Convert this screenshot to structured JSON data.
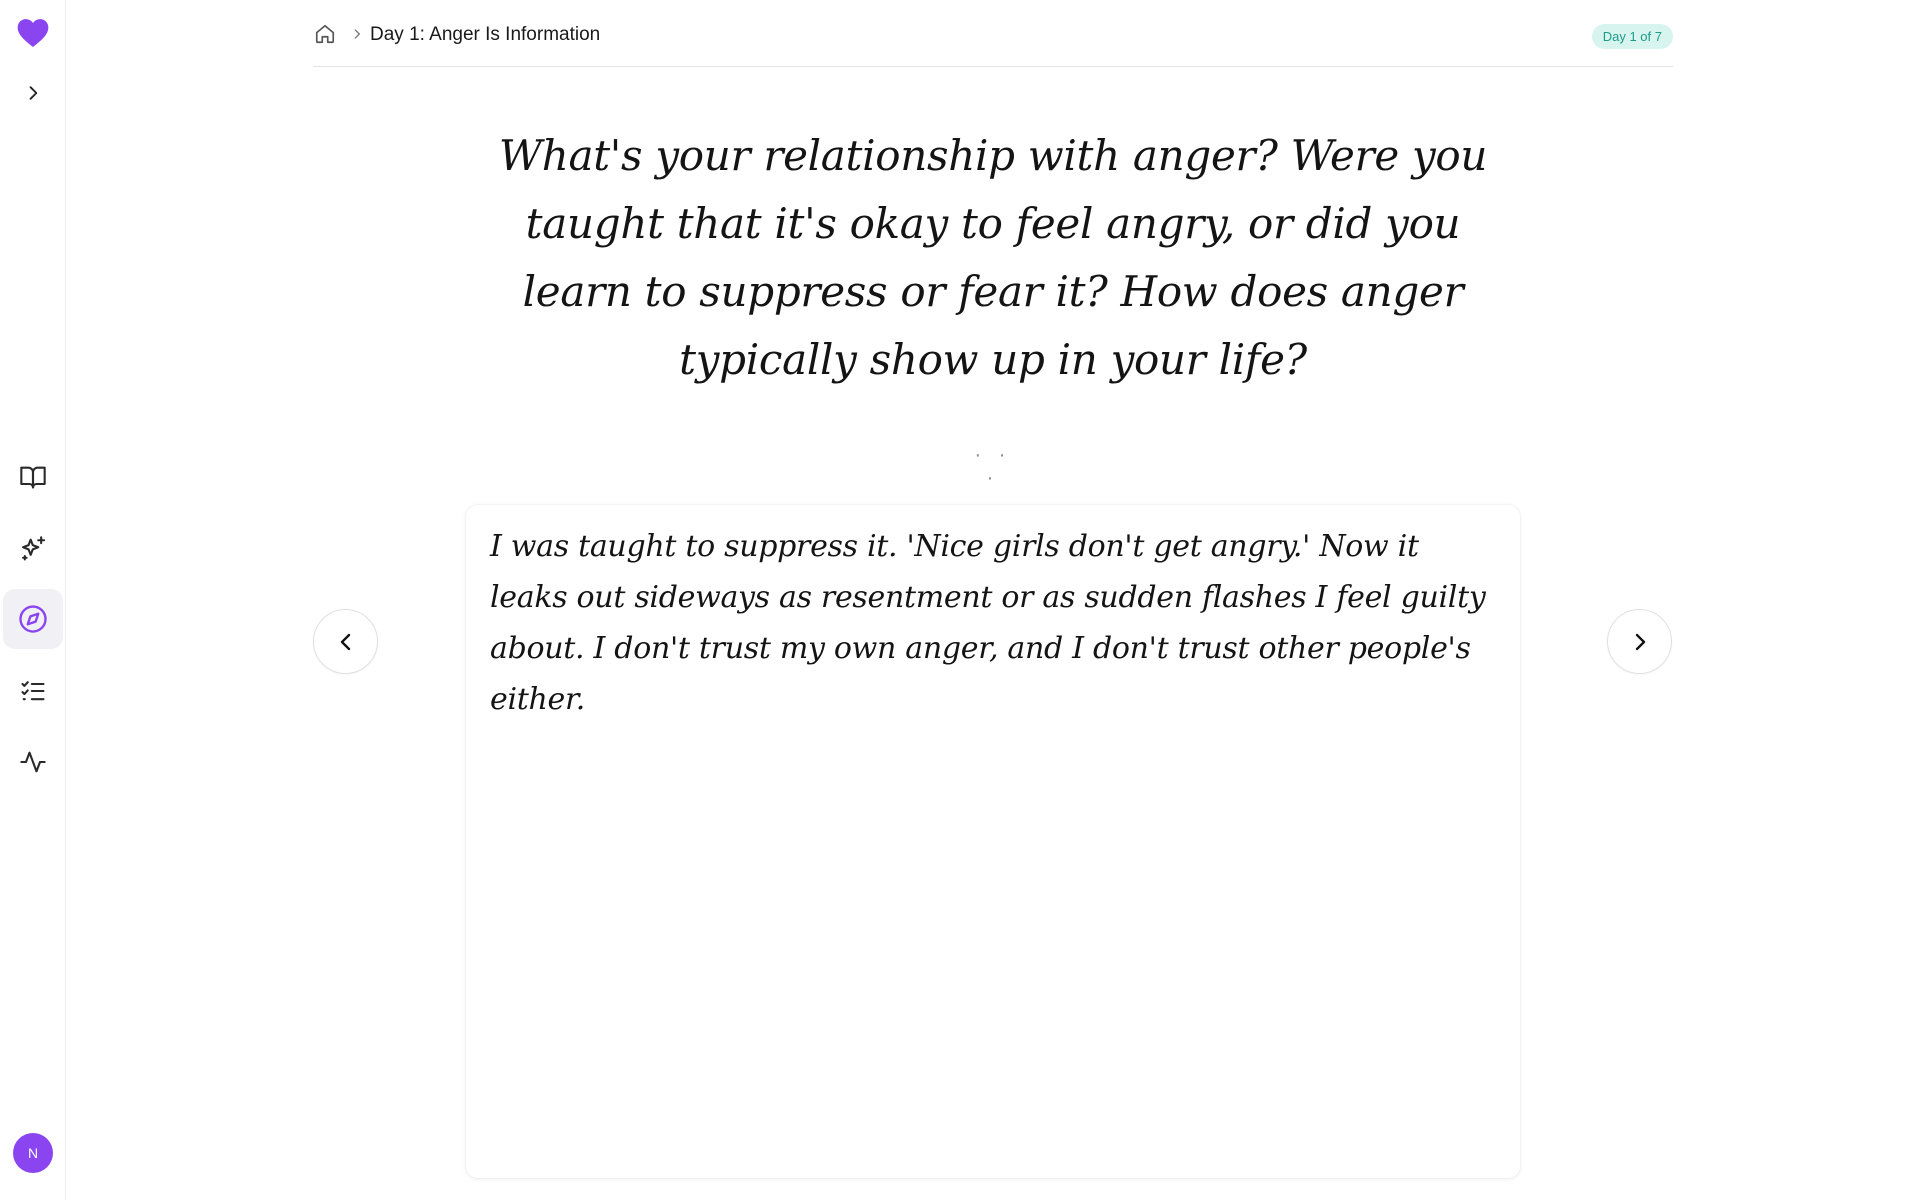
{
  "sidebar": {
    "brand_icon": "heart-icon",
    "accent_color": "#8b45f0",
    "items": [
      {
        "name": "book-open",
        "icon": "book-open-icon",
        "active": false
      },
      {
        "name": "sparkles",
        "icon": "sparkles-icon",
        "active": false
      },
      {
        "name": "compass",
        "icon": "compass-icon",
        "active": true
      },
      {
        "name": "checklist",
        "icon": "list-checks-icon",
        "active": false
      },
      {
        "name": "activity",
        "icon": "activity-icon",
        "active": false
      }
    ],
    "avatar_initial": "N"
  },
  "breadcrumb": {
    "home_icon": "home-icon",
    "separator_icon": "chevron-right-icon",
    "title": "Day 1: Anger Is Information"
  },
  "badge": {
    "label": "Day 1 of 7",
    "color": "#1e9b88",
    "background": "#d7f4ef"
  },
  "prompt": {
    "text": "What's your relationship with anger? Were you taught that it's okay to feel angry, or did you learn to suppress or fear it? How does anger typically show up in your life?"
  },
  "divider": "· · ·",
  "entry": {
    "text": "I was taught to suppress it. 'Nice girls don't get angry.' Now it leaks out sideways as resentment or as sudden flashes I feel guilty about. I don't trust my own anger, and I don't trust other people's either."
  },
  "navigation": {
    "prev_icon": "chevron-left-icon",
    "next_icon": "chevron-right-icon"
  }
}
